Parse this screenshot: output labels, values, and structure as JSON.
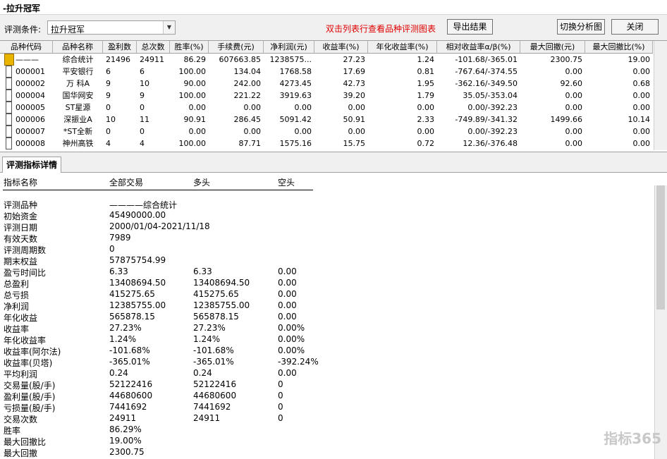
{
  "window": {
    "title": "-拉升冠军"
  },
  "toolbar": {
    "condition_label": "评测条件:",
    "condition_value": "拉升冠军",
    "hint": "双击列表行查看品种评测图表",
    "export_label": "导出结果",
    "switch_label": "切换分析图",
    "close_label": "关闭"
  },
  "grid": {
    "columns": [
      "品种代码",
      "品种名称",
      "盈利数",
      "总次数",
      "胜率(%)",
      "手续费(元)",
      "净利润(元)",
      "收益率(%)",
      "年化收益率(%)",
      "相对收益率α/β(%)",
      "最大回撤(元)",
      "最大回撤比(%)"
    ],
    "rows": [
      {
        "code": "———",
        "name": "综合统计",
        "win": "21496",
        "total": "24911",
        "rate": "86.29",
        "fee": "607663.85",
        "net": "1238575...",
        "ret": "27.23",
        "ann": "1.24",
        "rel": "-101.68/-365.01",
        "dd": "2300.75",
        "ddr": "19.00",
        "icon": "folder"
      },
      {
        "code": "000001",
        "name": "平安银行",
        "win": "6",
        "total": "6",
        "rate": "100.00",
        "fee": "134.04",
        "net": "1768.58",
        "ret": "17.69",
        "ann": "0.81",
        "rel": "-767.64/-374.55",
        "dd": "0.00",
        "ddr": "0.00",
        "icon": "doc"
      },
      {
        "code": "000002",
        "name": "万 科A",
        "win": "9",
        "total": "10",
        "rate": "90.00",
        "fee": "242.00",
        "net": "4273.45",
        "ret": "42.73",
        "ann": "1.95",
        "rel": "-362.16/-349.50",
        "dd": "92.60",
        "ddr": "0.68",
        "icon": "doc"
      },
      {
        "code": "000004",
        "name": "国华网安",
        "win": "9",
        "total": "9",
        "rate": "100.00",
        "fee": "221.22",
        "net": "3919.63",
        "ret": "39.20",
        "ann": "1.79",
        "rel": "35.05/-353.04",
        "dd": "0.00",
        "ddr": "0.00",
        "icon": "doc"
      },
      {
        "code": "000005",
        "name": "ST星源",
        "win": "0",
        "total": "0",
        "rate": "0.00",
        "fee": "0.00",
        "net": "0.00",
        "ret": "0.00",
        "ann": "0.00",
        "rel": "0.00/-392.23",
        "dd": "0.00",
        "ddr": "0.00",
        "icon": "doc"
      },
      {
        "code": "000006",
        "name": "深振业A",
        "win": "10",
        "total": "11",
        "rate": "90.91",
        "fee": "286.45",
        "net": "5091.42",
        "ret": "50.91",
        "ann": "2.33",
        "rel": "-749.89/-341.32",
        "dd": "1499.66",
        "ddr": "10.14",
        "icon": "doc"
      },
      {
        "code": "000007",
        "name": "*ST全新",
        "win": "0",
        "total": "0",
        "rate": "0.00",
        "fee": "0.00",
        "net": "0.00",
        "ret": "0.00",
        "ann": "0.00",
        "rel": "0.00/-392.23",
        "dd": "0.00",
        "ddr": "0.00",
        "icon": "doc"
      },
      {
        "code": "000008",
        "name": "神州高铁",
        "win": "4",
        "total": "4",
        "rate": "100.00",
        "fee": "87.71",
        "net": "1575.16",
        "ret": "15.75",
        "ann": "0.72",
        "rel": "12.36/-376.48",
        "dd": "0.00",
        "ddr": "0.00",
        "icon": "doc"
      }
    ]
  },
  "tab": {
    "label": "评测指标详情"
  },
  "detail": {
    "headers": [
      "指标名称",
      "全部交易",
      "多头",
      "空头"
    ],
    "rows": [
      {
        "name": "评测品种",
        "all": "————综合统计",
        "long": "",
        "short": ""
      },
      {
        "name": "初始资金",
        "all": "45490000.00",
        "long": "",
        "short": ""
      },
      {
        "name": "评测日期",
        "all": "2000/01/04-2021/11/18",
        "long": "",
        "short": ""
      },
      {
        "name": "有效天数",
        "all": "7989",
        "long": "",
        "short": ""
      },
      {
        "name": "评测周期数",
        "all": "0",
        "long": "",
        "short": ""
      },
      {
        "name": "期末权益",
        "all": "57875754.99",
        "long": "",
        "short": ""
      },
      {
        "name": "盈亏时间比",
        "all": "6.33",
        "long": "6.33",
        "short": "0.00"
      },
      {
        "name": "总盈利",
        "all": "13408694.50",
        "long": "13408694.50",
        "short": "0.00"
      },
      {
        "name": "总亏损",
        "all": "415275.65",
        "long": "415275.65",
        "short": "0.00"
      },
      {
        "name": "净利润",
        "all": "12385755.00",
        "long": "12385755.00",
        "short": "0.00"
      },
      {
        "name": "年化收益",
        "all": "565878.15",
        "long": "565878.15",
        "short": "0.00"
      },
      {
        "name": "收益率",
        "all": "27.23%",
        "long": "27.23%",
        "short": "0.00%"
      },
      {
        "name": "年化收益率",
        "all": "1.24%",
        "long": "1.24%",
        "short": "0.00%"
      },
      {
        "name": "收益率(阿尔法)",
        "all": "-101.68%",
        "long": "-101.68%",
        "short": "0.00%"
      },
      {
        "name": "收益率(贝塔)",
        "all": "-365.01%",
        "long": "-365.01%",
        "short": "-392.24%"
      },
      {
        "name": "平均利润",
        "all": "0.24",
        "long": "0.24",
        "short": "0.00"
      },
      {
        "name": "交易量(股/手)",
        "all": "52122416",
        "long": "52122416",
        "short": "0"
      },
      {
        "name": "盈利量(股/手)",
        "all": "44680600",
        "long": "44680600",
        "short": "0"
      },
      {
        "name": "亏损量(股/手)",
        "all": "7441692",
        "long": "7441692",
        "short": "0"
      },
      {
        "name": "交易次数",
        "all": "24911",
        "long": "24911",
        "short": "0"
      },
      {
        "name": "胜率",
        "all": "86.29%",
        "long": "",
        "short": ""
      },
      {
        "name": "最大回撤比",
        "all": "19.00%",
        "long": "",
        "short": ""
      },
      {
        "name": "最大回撤",
        "all": "2300.75",
        "long": "",
        "short": ""
      }
    ]
  },
  "watermark": "指标365"
}
